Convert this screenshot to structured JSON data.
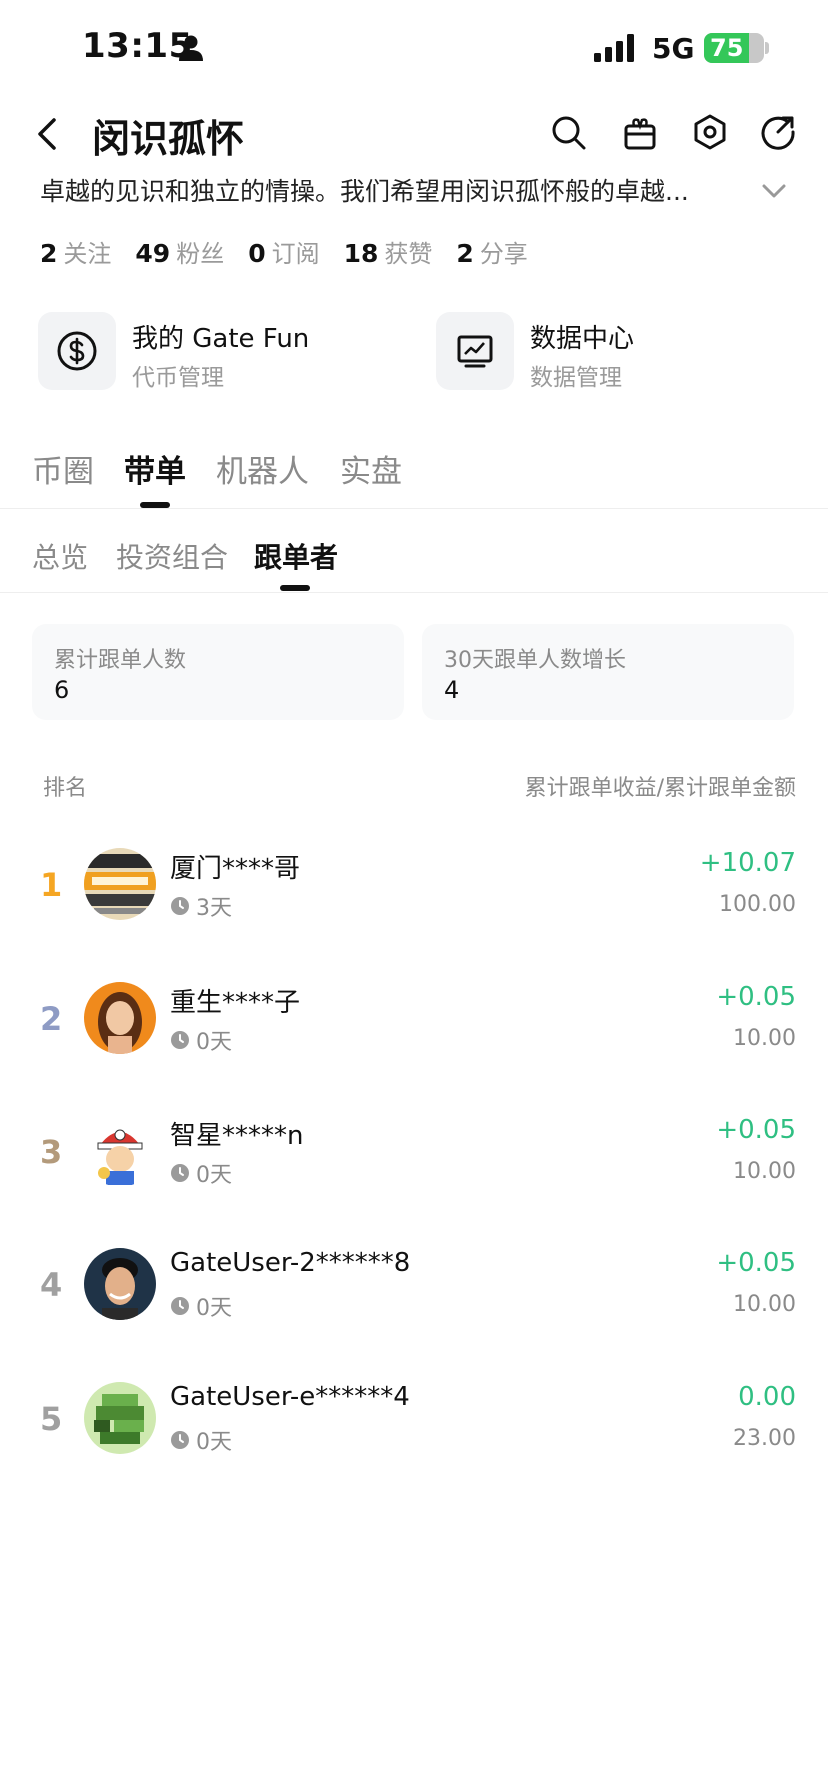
{
  "status_bar": {
    "time": "13:15",
    "network": "5G",
    "battery": "75",
    "battery_level": 0.75
  },
  "header": {
    "title": "闵识孤怀",
    "description": "卓越的见识和独立的情操。我们希望用闵识孤怀般的卓越..."
  },
  "stats": [
    {
      "value": "2",
      "label": "关注"
    },
    {
      "value": "49",
      "label": "粉丝"
    },
    {
      "value": "0",
      "label": "订阅"
    },
    {
      "value": "18",
      "label": "获赞"
    },
    {
      "value": "2",
      "label": "分享"
    }
  ],
  "cards": [
    {
      "title": "我的 Gate Fun",
      "subtitle": "代币管理"
    },
    {
      "title": "数据中心",
      "subtitle": "数据管理"
    }
  ],
  "main_tabs": [
    {
      "label": "币圈"
    },
    {
      "label": "带单"
    },
    {
      "label": "机器人"
    },
    {
      "label": "实盘"
    }
  ],
  "sub_tabs": [
    {
      "label": "总览"
    },
    {
      "label": "投资组合"
    },
    {
      "label": "跟单者"
    }
  ],
  "metrics": [
    {
      "label": "累计跟单人数",
      "value": "6"
    },
    {
      "label": "30天跟单人数增长",
      "value": "4"
    }
  ],
  "list_header": {
    "left": "排名",
    "right": "累计跟单收益/累计跟单金额"
  },
  "followers": [
    {
      "rank": "1",
      "name": "厦门****哥",
      "days": "3天",
      "profit": "+10.07",
      "amount": "100.00"
    },
    {
      "rank": "2",
      "name": "重生****子",
      "days": "0天",
      "profit": "+0.05",
      "amount": "10.00"
    },
    {
      "rank": "3",
      "name": "智星*****n",
      "days": "0天",
      "profit": "+0.05",
      "amount": "10.00"
    },
    {
      "rank": "4",
      "name": "GateUser-2******8",
      "days": "0天",
      "profit": "+0.05",
      "amount": "10.00"
    },
    {
      "rank": "5",
      "name": "GateUser-e******4",
      "days": "0天",
      "profit": "0.00",
      "amount": "23.00"
    }
  ],
  "colors": {
    "profit_green": "#2fbf82",
    "rank1": "#f5a623",
    "rank2": "#8e9bc4",
    "rank3": "#b39a7b",
    "rank_other": "#a0a0a0"
  }
}
